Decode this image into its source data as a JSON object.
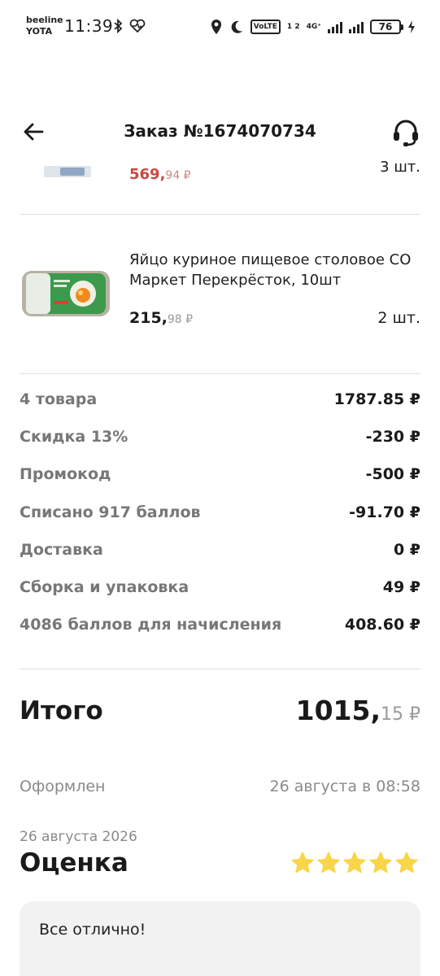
{
  "status_bar": {
    "carrier_1": "beeline",
    "carrier_2": "YOTA",
    "time": "11:39",
    "volte": "VoLTE",
    "sim_slots": "1 2",
    "network": "4G⁺",
    "battery": "76"
  },
  "header": {
    "title": "Заказ №1674070734"
  },
  "prev_item": {
    "price_main": "569,",
    "price_kop": "94 ₽",
    "qty": "3 шт."
  },
  "item": {
    "name": "Яйцо куриное пищевое столовое СО Маркет Перекрёсток, 10шт",
    "price_main": "215,",
    "price_kop": "98 ₽",
    "qty": "2 шт."
  },
  "summary": [
    {
      "label": "4 товара",
      "value": "1787.85 ₽"
    },
    {
      "label": "Скидка 13%",
      "value": "-230 ₽"
    },
    {
      "label": "Промокод",
      "value": "-500 ₽"
    },
    {
      "label": "Списано 917 баллов",
      "value": "-91.70 ₽"
    },
    {
      "label": "Доставка",
      "value": "0 ₽"
    },
    {
      "label": "Сборка и упаковка",
      "value": "49 ₽"
    },
    {
      "label": "4086 баллов для начисления",
      "value": "408.60 ₽"
    }
  ],
  "total": {
    "label": "Итого",
    "main": "1015,",
    "kop": "15 ₽"
  },
  "placed": {
    "label": "Оформлен",
    "value": "26 августа в 08:58"
  },
  "rating": {
    "date": "26 августа 2026",
    "title": "Оценка",
    "stars": 5,
    "star_color": "#f9d54a",
    "comment": "Все отлично!"
  }
}
